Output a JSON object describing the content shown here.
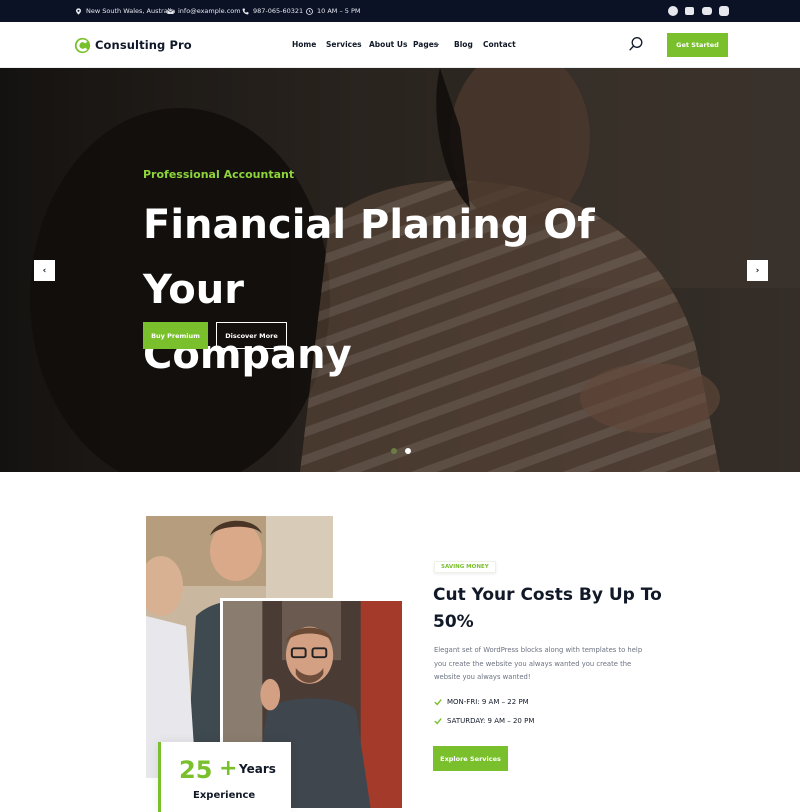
{
  "topbar": {
    "location": "New South Wales, Australia",
    "email": "info@example.com",
    "phone": "987-065-60321",
    "hours": "10 AM – 5 PM",
    "socials": [
      "facebook-icon",
      "twitter-icon",
      "youtube-icon",
      "instagram-icon"
    ]
  },
  "header": {
    "brand": "Consulting Pro",
    "nav": [
      "Home",
      "Services",
      "About Us",
      "Pages",
      "Blog",
      "Contact"
    ],
    "cta": "Get Started"
  },
  "hero": {
    "eyebrow": "Professional Accountant",
    "title_line1": "Financial Planing Of Your",
    "title_line2": "Company",
    "primary_button": "Buy Premium",
    "secondary_button": "Discover More",
    "prev": "‹",
    "next": "›",
    "slides": 2,
    "active_slide": 2
  },
  "about": {
    "experience_number": "25",
    "experience_plus": "+",
    "experience_unit": "Years",
    "experience_label": "Experience",
    "badge": "SAVING MONEY",
    "title": "Cut Your Costs By Up To 50%",
    "description": "Elegant set of WordPress blocks along with templates to help you create the website you always wanted you create the website you always wanted!",
    "schedule": [
      "MON-FRI: 9 AM – 22 PM",
      "SATURDAY: 9 AM – 20 PM"
    ],
    "button": "Explore Services"
  },
  "colors": {
    "accent": "#7ac02d",
    "dark": "#0b1226",
    "text": "#111827"
  }
}
